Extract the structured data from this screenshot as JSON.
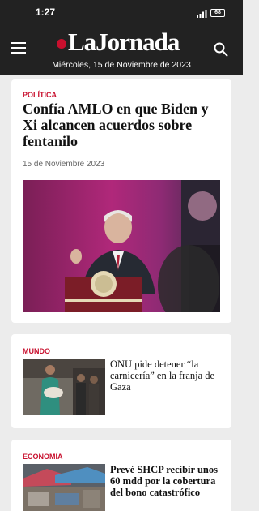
{
  "status_bar": {
    "time": "1:27",
    "battery": "68"
  },
  "app_bar": {
    "logo_text": "LaJornada",
    "date": "Miércoles, 15 de Noviembre de 2023",
    "menu_icon": "hamburger-menu-icon",
    "search_icon": "search-icon"
  },
  "colors": {
    "bar_background": "#222222",
    "accent": "#c8102e",
    "page_background": "#ececec",
    "card_background": "#ffffff"
  },
  "articles": [
    {
      "section": "POLÍTICA",
      "headline": "Confía AMLO en que Biden y Xi alcancen acuerdos sobre fentanilo",
      "date": "15 de Noviembre 2023"
    },
    {
      "section": "MUNDO",
      "headline": "ONU pide detener “la carnicería” en la franja de Gaza"
    },
    {
      "section": "ECONOMÍA",
      "headline": "Prevé SHCP recibir unos 60 mdd por la cobertura del bono catastrófico"
    }
  ]
}
